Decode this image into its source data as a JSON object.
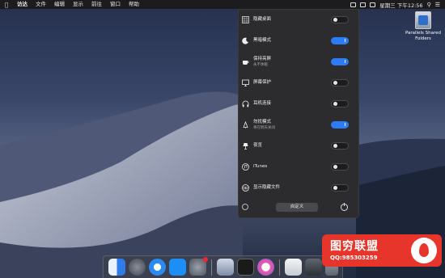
{
  "menubar": {
    "apple_icon": "apple-logo-icon",
    "items": [
      "访达",
      "文件",
      "编辑",
      "显示",
      "前往",
      "窗口",
      "帮助"
    ],
    "clock": "星期三 下午12:56"
  },
  "desktop": {
    "shared_folder_label": "Parallels Shared Folders"
  },
  "panel": {
    "rows": [
      {
        "icon": "desktop-grid-icon",
        "label": "隐藏桌面",
        "sub": "",
        "on": false
      },
      {
        "icon": "moon-icon",
        "label": "黑暗模式",
        "sub": "",
        "on": true
      },
      {
        "icon": "coffee-cup-icon",
        "label": "保持亮屏",
        "sub": "永不休眠",
        "on": true
      },
      {
        "icon": "monitor-icon",
        "label": "屏幕保护",
        "sub": "",
        "on": false
      },
      {
        "icon": "headphones-icon",
        "label": "耳机连接",
        "sub": "",
        "on": false
      },
      {
        "icon": "do-not-disturb-icon",
        "label": "勿扰模式",
        "sub": "将在明天关闭",
        "on": true
      },
      {
        "icon": "night-lamp-icon",
        "label": "夜览",
        "sub": "",
        "on": false
      },
      {
        "icon": "itunes-icon",
        "label": "iTunes",
        "sub": "",
        "on": false
      },
      {
        "icon": "eye-icon",
        "label": "显示隐藏文件",
        "sub": "",
        "on": false
      }
    ],
    "customize_label": "自定义"
  },
  "dock": {
    "apps": [
      "finder-icon",
      "launchpad-icon",
      "safari-icon",
      "app-store-icon",
      "system-preferences-icon",
      "files-icon",
      "terminal-icon",
      "itunes-icon",
      "preview-icon",
      "window-icon",
      "trash-icon"
    ]
  },
  "watermark": {
    "title": "图穷联盟",
    "qq": "QQ:985303259"
  },
  "colors": {
    "accent": "#2e7bf6",
    "panel_bg": "#2c2c2e",
    "watermark_red": "#e8352b"
  }
}
